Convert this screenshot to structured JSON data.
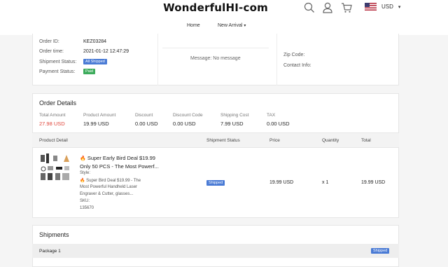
{
  "header": {
    "brand": "WonderfulHI-com",
    "icons": [
      "search-icon",
      "user-icon",
      "cart-icon"
    ],
    "currency": "USD"
  },
  "nav": {
    "home": "Home",
    "new_arrival": "New Arrival"
  },
  "order_info": {
    "order_id_label": "Order ID:",
    "order_id": "KEZ03284",
    "order_time_label": "Order time:",
    "order_time": "2021-01-12 12:47:29",
    "shipment_status_label": "Shipment Status:",
    "shipment_status": "All Shipped",
    "payment_status_label": "Payment Status:",
    "payment_status": "Paid",
    "message": "Message: No message",
    "zip_label": "Zip Code:",
    "contact_label": "Contact Info:"
  },
  "order_details": {
    "title": "Order Details",
    "summary": [
      {
        "label": "Total Amount",
        "value": "27.98 USD",
        "color": "#e0453a"
      },
      {
        "label": "Product Amount",
        "value": "19.99 USD"
      },
      {
        "label": "Discount",
        "value": "0.00 USD"
      },
      {
        "label": "Discount Code",
        "value": "0.00 USD"
      },
      {
        "label": "Shipping Cost",
        "value": "7.99 USD"
      },
      {
        "label": "TAX",
        "value": "0.00 USD"
      }
    ],
    "columns": [
      "Product Detail",
      "Shipment Status",
      "Price",
      "Quantity",
      "Total"
    ],
    "item": {
      "title_line1": "Super Early Bird Deal $19.99",
      "title_line2": "Only 50 PCS - The Most Powerf...",
      "style_label": "Style:",
      "style_line1": "Super Bird Deal $19.99 - The",
      "style_line2": "Most Powerful Handheld Laser",
      "style_line3": "Engraver & Cutter, glasses...",
      "sku_label": "SKU:",
      "sku": "135670",
      "status": "Shipped",
      "price": "19.99 USD",
      "quantity": "x 1",
      "total": "19.99 USD"
    }
  },
  "shipments": {
    "title": "Shipments",
    "package_label": "Package 1",
    "package_status": "Shipped"
  }
}
